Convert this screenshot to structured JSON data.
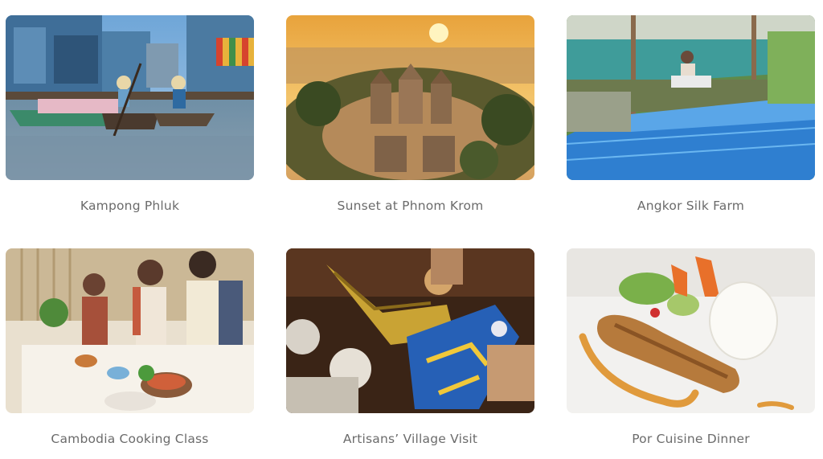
{
  "tours": [
    {
      "title": "Kampong Phluk",
      "image": "floating-village-photo"
    },
    {
      "title": "Sunset at Phnom Krom",
      "image": "temple-sunset-photo"
    },
    {
      "title": "Angkor Silk Farm",
      "image": "silk-weaving-photo"
    },
    {
      "title": "Cambodia Cooking Class",
      "image": "cooking-class-photo"
    },
    {
      "title": "Artisans’ Village Visit",
      "image": "mask-painting-photo"
    },
    {
      "title": "Por Cuisine Dinner",
      "image": "plated-dinner-photo"
    }
  ]
}
